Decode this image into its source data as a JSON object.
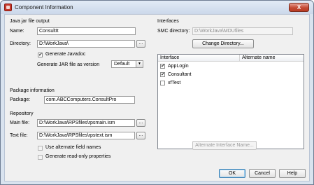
{
  "window": {
    "title": "Component Information",
    "close_glyph": "X"
  },
  "java": {
    "section_label": "Java jar file output",
    "name_label": "Name:",
    "name_value": "ConsultIt",
    "directory_label": "Directory:",
    "directory_value": "D:\\WorkJava\\",
    "browse_label": "...",
    "generate_javadoc_label": "Generate Javadoc",
    "generate_javadoc_checked": true,
    "jar_version_label": "Generate JAR file as version",
    "jar_version_value": "Default"
  },
  "package": {
    "section_label": "Package information",
    "package_label": "Package:",
    "package_value": "com.ABCComputers.ConsultPro"
  },
  "repository": {
    "section_label": "Repository",
    "main_file_label": "Main file:",
    "main_file_value": "D:\\WorkJava\\RPSfiles\\rpsmain.ism",
    "text_file_label": "Text file:",
    "text_file_value": "D:\\WorkJava\\RPSfiles\\rpstext.ism",
    "alt_field_names_label": "Use alternate field names",
    "alt_field_names_checked": false,
    "read_only_label": "Generate read-only properties",
    "read_only_checked": false
  },
  "interfaces": {
    "section_label": "Interfaces",
    "smc_label": "SMC directory:",
    "smc_value": "D:\\WorkJava\\MDUfiles",
    "change_dir_label": "Change Directory...",
    "columns": [
      "Interface",
      "Alternate name"
    ],
    "rows": [
      {
        "name": "AppLogin",
        "checked": true,
        "check_glyph": "✔"
      },
      {
        "name": "Consultant",
        "checked": true,
        "check_glyph": "✔"
      },
      {
        "name": "xfTest",
        "checked": false,
        "check_glyph": ""
      }
    ],
    "alt_interface_name_label": "Alternate Interface Name..."
  },
  "buttons": {
    "ok": "OK",
    "cancel": "Cancel",
    "help": "Help"
  },
  "glyphs": {
    "check": "✔",
    "dropdown": "▼"
  }
}
